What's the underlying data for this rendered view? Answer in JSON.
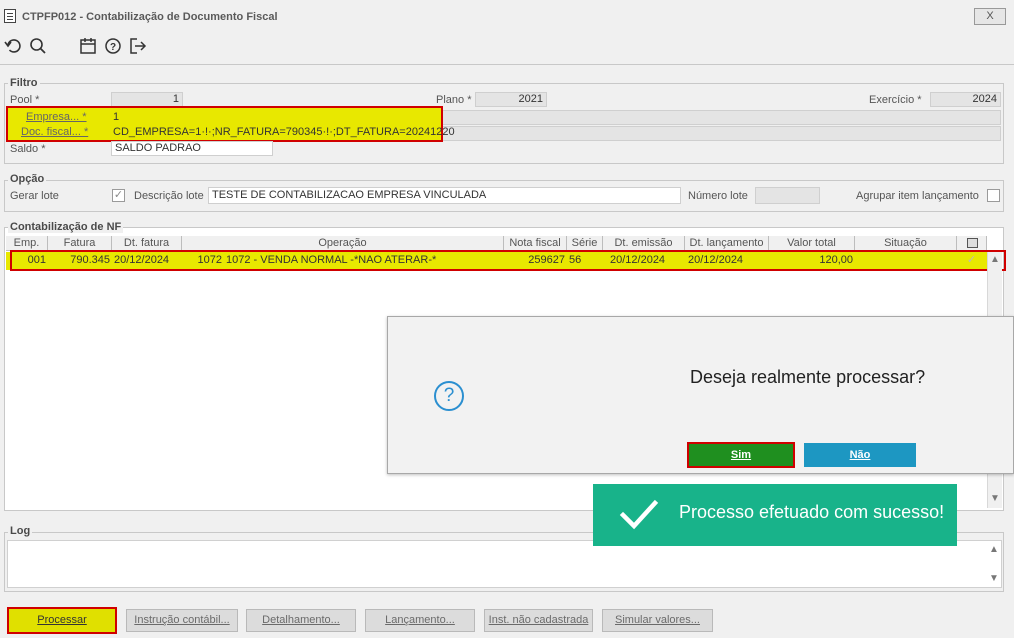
{
  "window": {
    "title": "CTPFP012 - Contabilização de Documento Fiscal",
    "close_label": "X"
  },
  "toolbar": {
    "icons": [
      "undo-icon",
      "search-icon",
      "calendar-icon",
      "help-icon",
      "exit-icon"
    ]
  },
  "filtro": {
    "legend": "Filtro",
    "pool_label": "Pool *",
    "pool_value": "1",
    "plano_label": "Plano *",
    "plano_value": "2021",
    "exercicio_label": "Exercício *",
    "exercicio_value": "2024",
    "empresa_label": "Empresa... *",
    "empresa_value": "1",
    "doc_label": "Doc. fiscal... *",
    "doc_value": "CD_EMPRESA=1·!·;NR_FATURA=790345·!·;DT_FATURA=20241220",
    "saldo_label": "Saldo *",
    "saldo_value": "SALDO PADRAO"
  },
  "opcao": {
    "legend": "Opção",
    "gerar_lote_label": "Gerar lote",
    "descricao_label": "Descrição lote",
    "descricao_value": "TESTE DE CONTABILIZACAO EMPRESA VINCULADA",
    "numero_label": "Número lote",
    "numero_value": "",
    "agrupar_label": "Agrupar item lançamento"
  },
  "nf": {
    "legend": "Contabilização de NF",
    "columns": [
      "Emp.",
      "Fatura",
      "Dt. fatura",
      "Operação",
      "Nota fiscal",
      "Série",
      "Dt. emissão",
      "Dt. lançamento",
      "Valor total",
      "Situação"
    ],
    "row": {
      "emp": "001",
      "fatura": "790.345",
      "dt_fatura": "20/12/2024",
      "op_code": "1072",
      "operacao": "1072 - VENDA NORMAL -*NAO ATERAR-*",
      "nota": "259627",
      "serie": "56",
      "dt_emissao": "20/12/2024",
      "dt_lancamento": "20/12/2024",
      "valor": "120,00",
      "situacao": ""
    }
  },
  "log": {
    "legend": "Log"
  },
  "dialog": {
    "message": "Deseja realmente processar?",
    "yes_label": "Sim",
    "no_label": "Não"
  },
  "toast": {
    "message": "Processo efetuado com sucesso!"
  },
  "buttons": {
    "processar": "Processar",
    "instrucao": "Instrução contábil...",
    "detalhamento": "Detalhamento...",
    "lancamento": "Lançamento...",
    "inst_nao": "Inst. não cadastrada",
    "simular": "Simular valores..."
  },
  "colors": {
    "highlight_yellow": "#e8e800",
    "highlight_red": "#d00000",
    "toast_green": "#18b38a",
    "sim_green": "#1f8f1f",
    "nao_blue": "#1d97c2"
  }
}
